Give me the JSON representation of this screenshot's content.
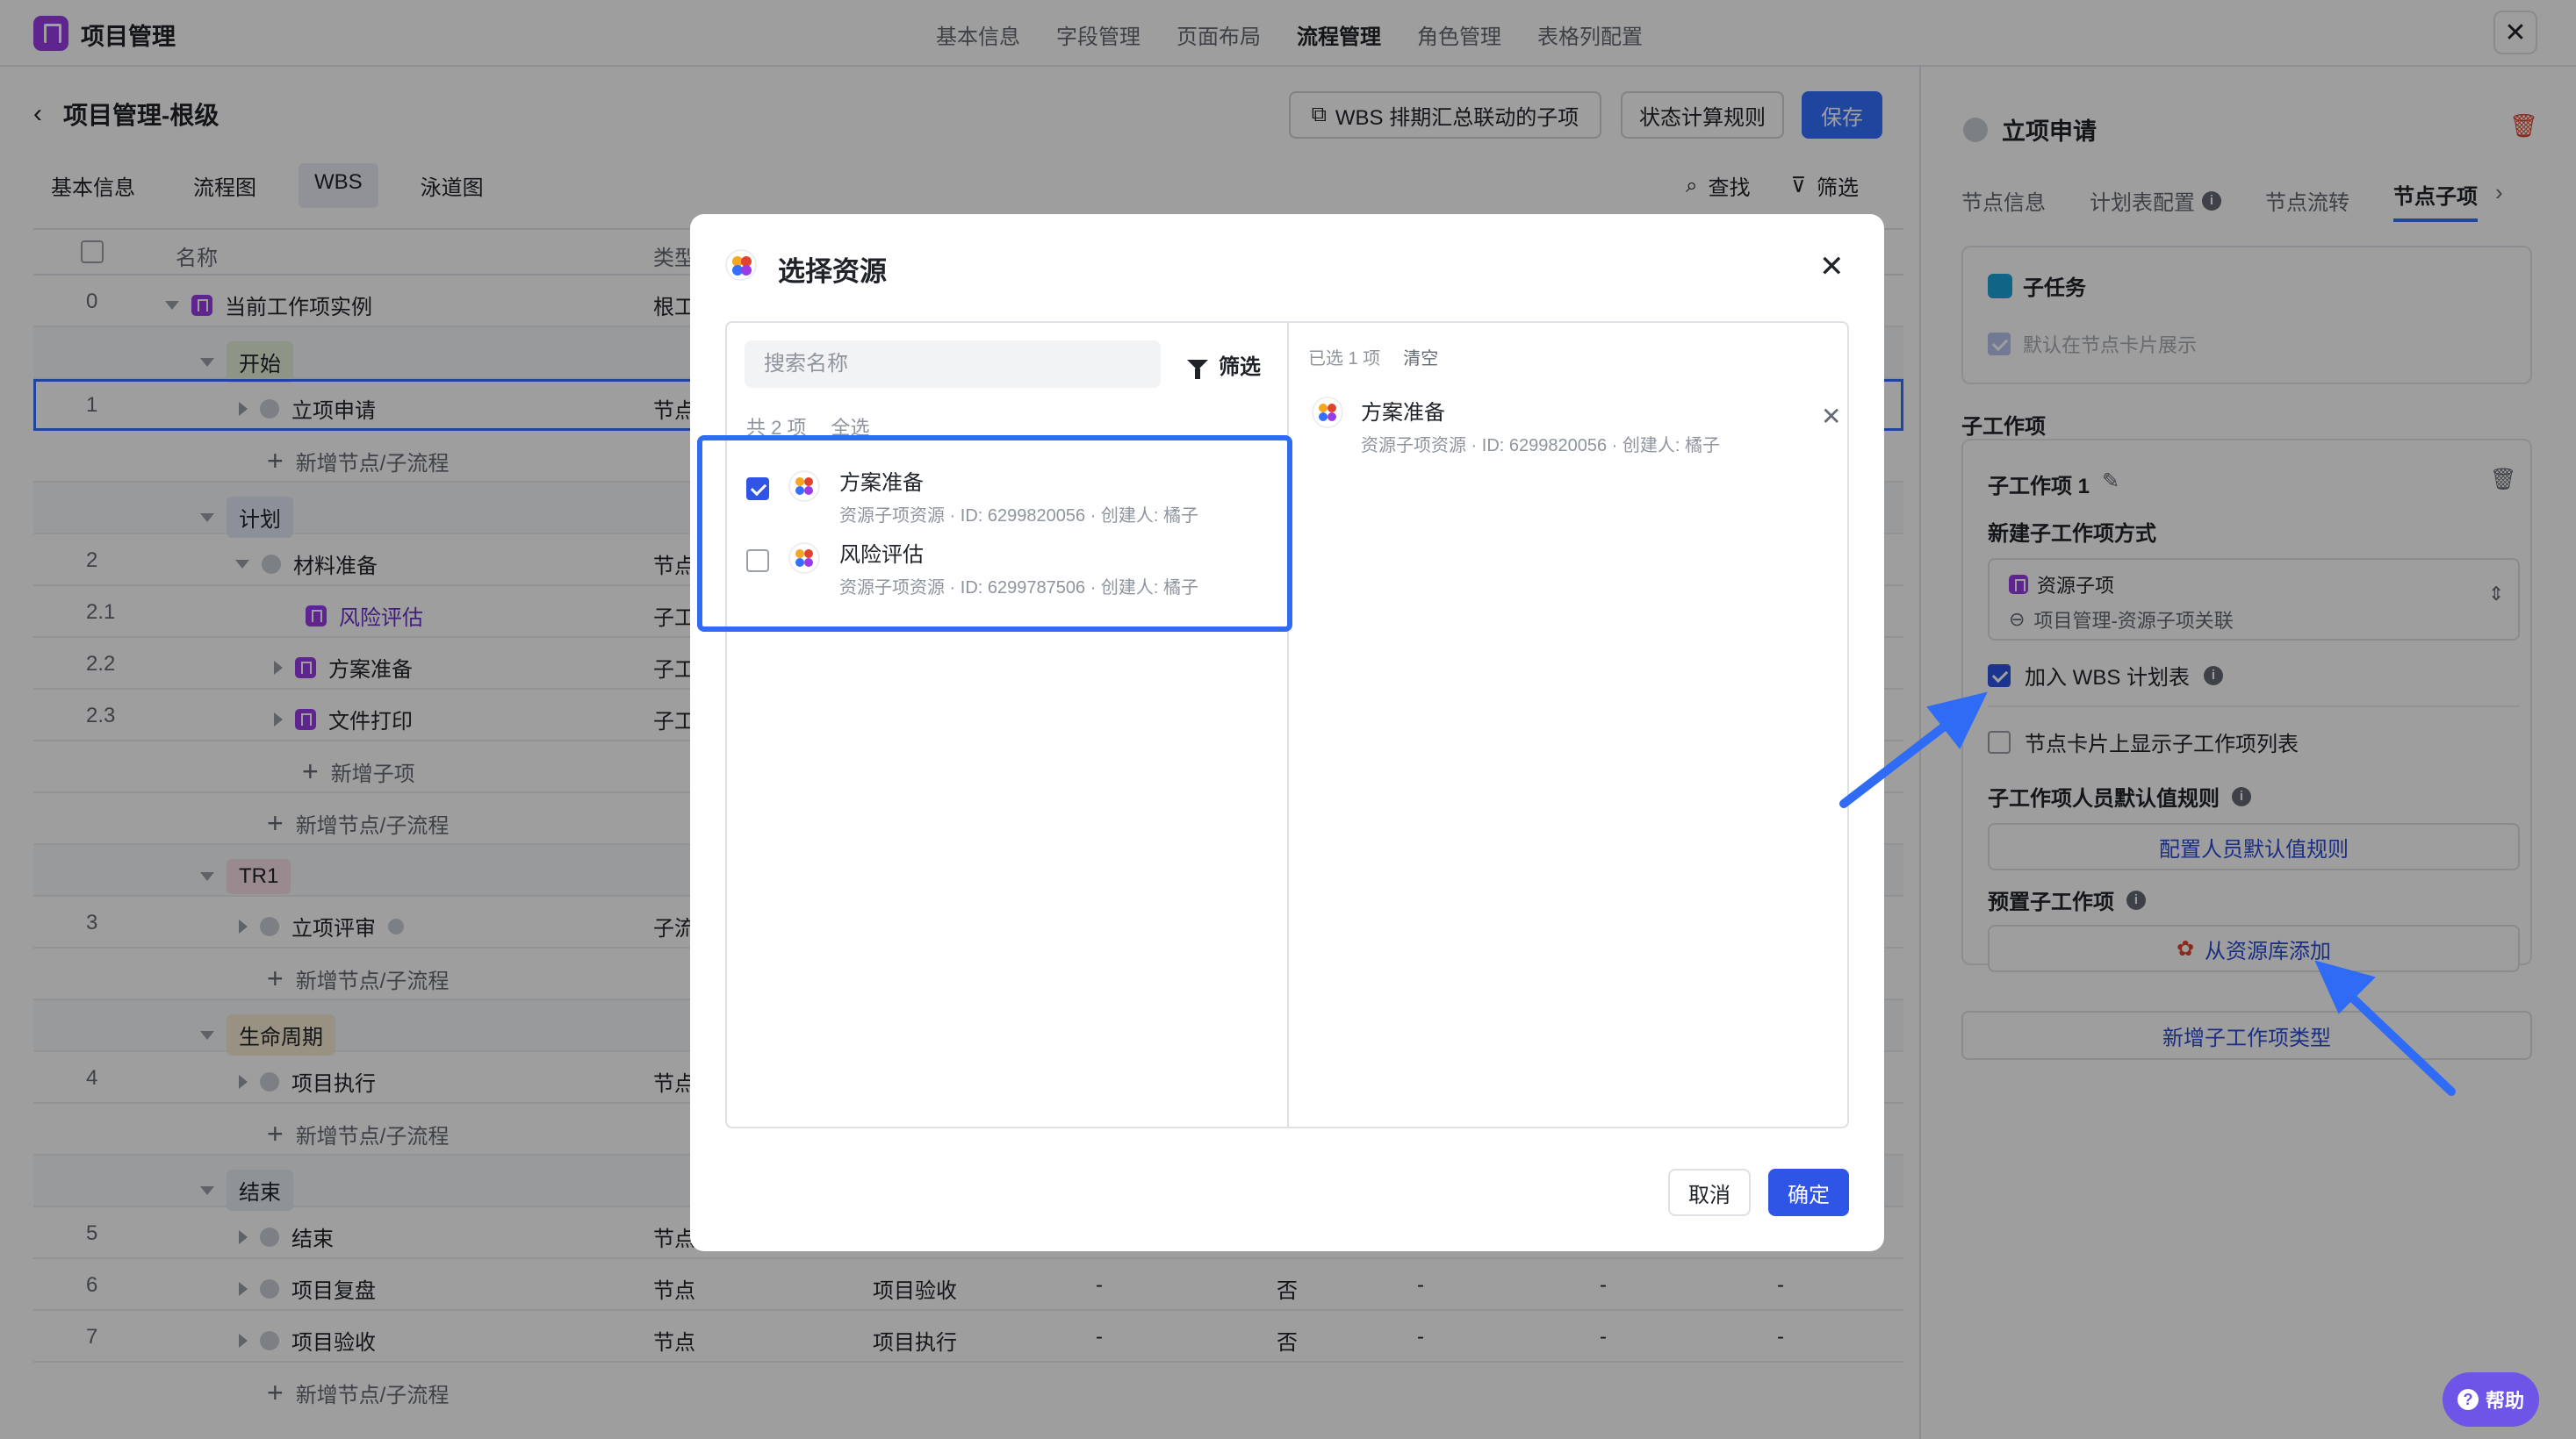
{
  "app": {
    "title": "项目管理"
  },
  "topnav": [
    "基本信息",
    "字段管理",
    "页面布局",
    "流程管理",
    "角色管理",
    "表格列配置"
  ],
  "page": {
    "title": "项目管理-根级",
    "buttons": {
      "wbs": "WBS 排期汇总联动的子项",
      "status_rule": "状态计算规则",
      "save": "保存"
    },
    "tabs": [
      "基本信息",
      "流程图",
      "WBS",
      "泳道图"
    ],
    "tools": {
      "find": "查找",
      "filter": "筛选"
    }
  },
  "grid": {
    "header": {
      "name": "名称",
      "type": "类型"
    },
    "rows": [
      {
        "num": "0",
        "name": "当前工作项实例",
        "type": "根工"
      },
      {
        "stage": "开始"
      },
      {
        "num": "1",
        "name": "立项申请",
        "type": "节点"
      },
      {
        "add": "新增节点/子流程"
      },
      {
        "stage": "计划"
      },
      {
        "num": "2",
        "name": "材料准备",
        "type": "节点"
      },
      {
        "num": "2.1",
        "name": "风险评估",
        "type": "子工"
      },
      {
        "num": "2.2",
        "name": "方案准备",
        "type": "子工"
      },
      {
        "num": "2.3",
        "name": "文件打印",
        "type": "子工"
      },
      {
        "add": "新增子项"
      },
      {
        "add": "新增节点/子流程"
      },
      {
        "stage": "TR1"
      },
      {
        "num": "3",
        "name": "立项评审",
        "type": "子流"
      },
      {
        "add": "新增节点/子流程"
      },
      {
        "stage": "生命周期"
      },
      {
        "num": "4",
        "name": "项目执行",
        "type": "节点"
      },
      {
        "add": "新增节点/子流程"
      },
      {
        "stage": "结束"
      },
      {
        "num": "5",
        "name": "结束",
        "type": "节点"
      },
      {
        "num": "6",
        "name": "项目复盘",
        "type": "节点",
        "c3": "项目验收",
        "c4": "-",
        "c5": "否",
        "c6": "-",
        "c7": "-",
        "c8": "-"
      },
      {
        "num": "7",
        "name": "项目验收",
        "type": "节点",
        "c3": "项目执行",
        "c4": "-",
        "c5": "否",
        "c6": "-",
        "c7": "-",
        "c8": "-"
      },
      {
        "add": "新增节点/子流程"
      }
    ]
  },
  "right_panel": {
    "node_title": "立项申请",
    "tabs": [
      "节点信息",
      "计划表配置",
      "节点流转",
      "节点子项"
    ],
    "subtask": {
      "label": "子任务",
      "default_show": "默认在节点卡片展示"
    },
    "child_section": "子工作项",
    "child_item_title": "子工作项 1",
    "create_method_label": "新建子工作项方式",
    "create_method_value": "资源子项",
    "create_method_sub": "项目管理-资源子项关联",
    "join_wbs": "加入 WBS 计划表",
    "show_on_card": "节点卡片上显示子工作项列表",
    "default_rule_label": "子工作项人员默认值规则",
    "config_rule_btn": "配置人员默认值规则",
    "preset_label": "预置子工作项",
    "add_from_lib": "从资源库添加",
    "add_type": "新增子工作项类型"
  },
  "modal": {
    "title": "选择资源",
    "search_placeholder": "搜索名称",
    "filter": "筛选",
    "count": "共 2 项",
    "select_all": "全选",
    "items": [
      {
        "name": "方案准备",
        "meta": "资源子项资源 · ID: 6299820056 · 创建人: 橘子",
        "checked": true
      },
      {
        "name": "风险评估",
        "meta": "资源子项资源 · ID: 6299787506 · 创建人: 橘子",
        "checked": false
      }
    ],
    "selected_label": "已选 1 项",
    "clear": "清空",
    "selected_item": {
      "name": "方案准备",
      "meta": "资源子项资源 · ID: 6299820056 · 创建人: 橘子"
    },
    "cancel": "取消",
    "ok": "确定"
  },
  "help": "帮助",
  "colors": {
    "accent": "#3370ff",
    "brand": "#9a3ce6",
    "arrow": "#2f6bf5"
  }
}
